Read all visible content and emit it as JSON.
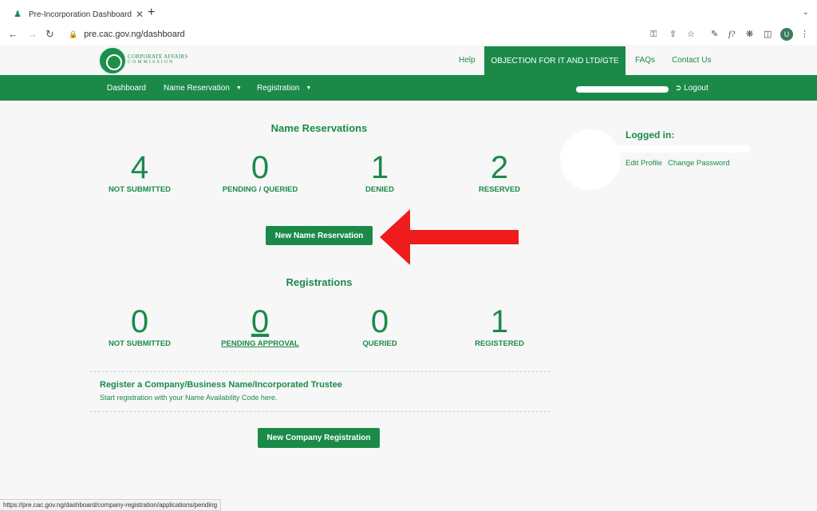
{
  "browser": {
    "tab_title": "Pre-Incorporation Dashboard",
    "url": "pre.cac.gov.ng/dashboard",
    "status_url": "https://pre.cac.gov.ng/dashboard/company-registration/applications/pending",
    "avatar_letter": "U"
  },
  "header": {
    "logo_line1": "CORPORATE AFFAIRS",
    "logo_line2": "COMMISSION",
    "links": {
      "help": "Help",
      "objection": "OBJECTION FOR IT AND LTD/GTE",
      "faqs": "FAQs",
      "contact": "Contact Us"
    }
  },
  "nav": {
    "dashboard": "Dashboard",
    "name_reservation": "Name Reservation",
    "registration": "Registration",
    "logout": "Logout"
  },
  "name_reservations": {
    "title": "Name Reservations",
    "stats": [
      {
        "value": "4",
        "label": "NOT SUBMITTED"
      },
      {
        "value": "0",
        "label": "PENDING / QUERIED"
      },
      {
        "value": "1",
        "label": "DENIED"
      },
      {
        "value": "2",
        "label": "RESERVED"
      }
    ],
    "button": "New Name Reservation"
  },
  "registrations": {
    "title": "Registrations",
    "stats": [
      {
        "value": "0",
        "label": "NOT SUBMITTED"
      },
      {
        "value": "0",
        "label": "PENDING APPROVAL"
      },
      {
        "value": "0",
        "label": "QUERIED"
      },
      {
        "value": "1",
        "label": "REGISTERED"
      }
    ],
    "register_title": "Register a Company/Business Name/Incorporated Trustee",
    "register_subtitle": "Start registration with your Name Availability Code here.",
    "button": "New Company Registration"
  },
  "profile": {
    "logged_in": "Logged in:",
    "edit_profile": "Edit Profile",
    "change_password": "Change Password"
  },
  "colors": {
    "brand_green": "#1b8a49",
    "arrow_red": "#ee1c1c"
  }
}
